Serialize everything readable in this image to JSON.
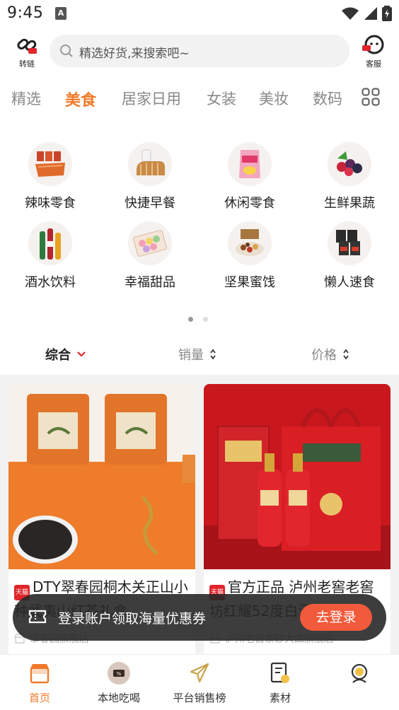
{
  "status_bar": {
    "time": "9:45",
    "sim_label": "A"
  },
  "header": {
    "left_button": {
      "label": "转链",
      "icon": "link-icon"
    },
    "search": {
      "placeholder": "精选好货,来搜索吧~"
    },
    "right_button": {
      "label": "客服",
      "icon": "customer-service-icon"
    }
  },
  "tabs": [
    {
      "label": "精选",
      "active": false
    },
    {
      "label": "美食",
      "active": true
    },
    {
      "label": "居家日用",
      "active": false
    },
    {
      "label": "女装",
      "active": false
    },
    {
      "label": "美妆",
      "active": false
    },
    {
      "label": "数码",
      "active": false
    }
  ],
  "subcategories": [
    {
      "label": "辣味零食",
      "icon": "spicy-snack-icon"
    },
    {
      "label": "快捷早餐",
      "icon": "bread-icon"
    },
    {
      "label": "休闲零食",
      "icon": "chips-icon"
    },
    {
      "label": "生鲜果蔬",
      "icon": "berries-icon"
    },
    {
      "label": "酒水饮料",
      "icon": "bottles-icon"
    },
    {
      "label": "幸福甜品",
      "icon": "macaron-icon"
    },
    {
      "label": "坚果蜜饯",
      "icon": "nuts-icon"
    },
    {
      "label": "懒人速食",
      "icon": "instant-noodle-icon"
    }
  ],
  "pagination": {
    "pages": 2,
    "current": 1
  },
  "sort_options": [
    {
      "label": "综合",
      "active": true,
      "icon": "chevron-down-icon"
    },
    {
      "label": "销量",
      "active": false,
      "icon": "sort-arrows-icon"
    },
    {
      "label": "价格",
      "active": false,
      "icon": "sort-arrows-icon"
    }
  ],
  "products": [
    {
      "badge": "天猫",
      "title": "DTY翠春园桐木关正山小种武夷山红茶礼盒",
      "shop": "翠春园旗舰店"
    },
    {
      "badge": "天猫",
      "title": "官方正品 泸州老窖老窖坊红耀52度白酒礼盒",
      "shop": "泸州老窖紫砂大曲旗舰店"
    }
  ],
  "login_toast": {
    "text": "登录账户领取海量优惠券",
    "button": "去登录"
  },
  "bottom_nav": [
    {
      "label": "首页",
      "icon": "home-store-icon",
      "active": true
    },
    {
      "label": "本地吃喝",
      "icon": "local-food-icon",
      "active": false
    },
    {
      "label": "平台销售榜",
      "icon": "plane-icon",
      "active": false
    },
    {
      "label": "素材",
      "icon": "document-icon",
      "active": false
    },
    {
      "label": "",
      "icon": "profile-icon",
      "active": false
    }
  ],
  "colors": {
    "accent": "#f07a2a",
    "toast_button": "#f15a3a",
    "tmall_red": "#e0252b"
  }
}
